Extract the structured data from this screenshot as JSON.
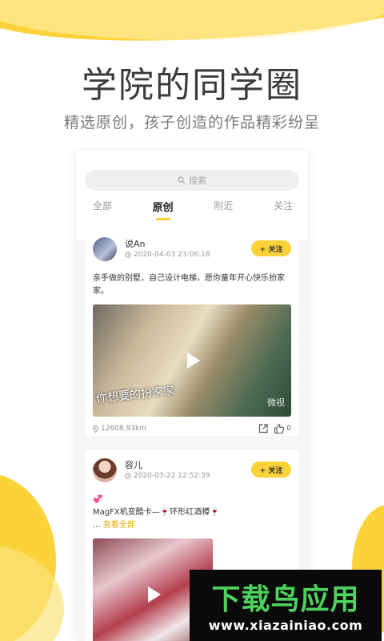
{
  "header": {
    "title": "学院的同学圈",
    "subtitle": "精选原创，孩子创造的作品精彩纷呈"
  },
  "search": {
    "placeholder": "搜索",
    "icon": "search-icon"
  },
  "tabs": [
    {
      "label": "全部",
      "active": false
    },
    {
      "label": "原创",
      "active": true
    },
    {
      "label": "附近",
      "active": false
    },
    {
      "label": "关注",
      "active": false
    }
  ],
  "posts": [
    {
      "user": "说An",
      "time": "2020-04-03 23:06:18",
      "follow_label": "+ 关注",
      "text": "亲手做的别墅，自己设计电梯，愿你童年开心快乐扮家家。",
      "video_caption": "你想要的扮家家",
      "video_watermark": "微视",
      "distance": "12608.93km",
      "likes": "0"
    },
    {
      "user": "容儿",
      "time": "2020-03-22 12:52:39",
      "follow_label": "+ 关注",
      "text": "💞\nMagFX机变酷卡—🍷环形红酒樽🍷",
      "ellipsis": "...",
      "more_label": "查看全部"
    }
  ],
  "promo": {
    "title": "下载鸟应用",
    "url": "www.xiazainiao.com"
  },
  "colors": {
    "accent": "#fcd23a",
    "promo_text": "#4dd25e"
  }
}
